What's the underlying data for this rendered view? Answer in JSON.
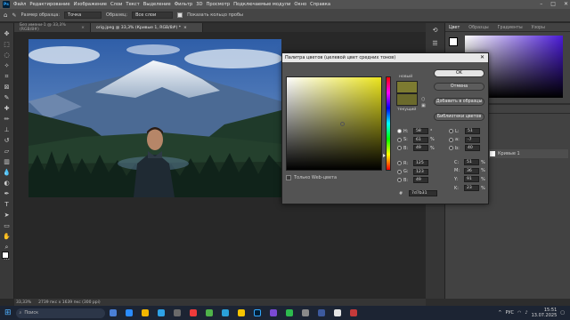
{
  "menubar": {
    "app_icon": "Ps",
    "items": [
      "Файл",
      "Редактирование",
      "Изображение",
      "Слои",
      "Текст",
      "Выделение",
      "Фильтр",
      "3D",
      "Просмотр",
      "Подключаемые модули",
      "Окно",
      "Справка"
    ]
  },
  "options": {
    "sample_size_label": "Размер образца:",
    "sample_size_value": "Точка",
    "sample_label": "Образец:",
    "sample_value": "Все слои",
    "show_ring_label": "Показать кольцо пробы"
  },
  "tabs": [
    {
      "label": "Без имени-1 @ 33,3% (RGB/8#)"
    },
    {
      "label": "orig.jpeg @ 33,3% (Кривые 1, RGB/8#) *"
    }
  ],
  "status": {
    "zoom": "33,33%",
    "info": "2739 пкс x 1639 пкс (300 ppi)"
  },
  "color_panel": {
    "tabs": [
      "Цвет",
      "Образцы",
      "Градиенты",
      "Узоры"
    ]
  },
  "layers_panel": {
    "tab": "Свойства",
    "layer_name": "Кривые 1"
  },
  "dialog": {
    "title": "Палитра цветов (целевой цвет средних тонов)",
    "new_label": "новый",
    "current_label": "текущий",
    "ok_label": "OK",
    "cancel_label": "Отмена",
    "add_swatch_label": "Добавить в образцы",
    "libraries_label": "Библиотеки цветов",
    "web_only_label": "Только Web-цвета",
    "hsb": [
      {
        "l": "H:",
        "v": "58",
        "u": "°"
      },
      {
        "l": "S:",
        "v": "61",
        "u": "%"
      },
      {
        "l": "B:",
        "v": "49",
        "u": "%"
      }
    ],
    "rgb": [
      {
        "l": "R:",
        "v": "125",
        "u": ""
      },
      {
        "l": "G:",
        "v": "123",
        "u": ""
      },
      {
        "l": "B:",
        "v": "49",
        "u": ""
      }
    ],
    "lab": [
      {
        "l": "L:",
        "v": "51",
        "u": ""
      },
      {
        "l": "a:",
        "v": "-7",
        "u": ""
      },
      {
        "l": "b:",
        "v": "40",
        "u": ""
      }
    ],
    "cmyk": [
      {
        "l": "C:",
        "v": "51",
        "u": "%"
      },
      {
        "l": "M:",
        "v": "36",
        "u": "%"
      },
      {
        "l": "Y:",
        "v": "91",
        "u": "%"
      },
      {
        "l": "K:",
        "v": "23",
        "u": "%"
      }
    ],
    "hex_label": "#",
    "hex_value": "7d7b31",
    "new_color": "#7d7b31",
    "current_color": "#6b6a2c",
    "field_hue": "#ece51e"
  },
  "taskbar": {
    "search_placeholder": "Поиск",
    "lang": "РУС",
    "time": "15:51",
    "date": "13.07.2025"
  }
}
